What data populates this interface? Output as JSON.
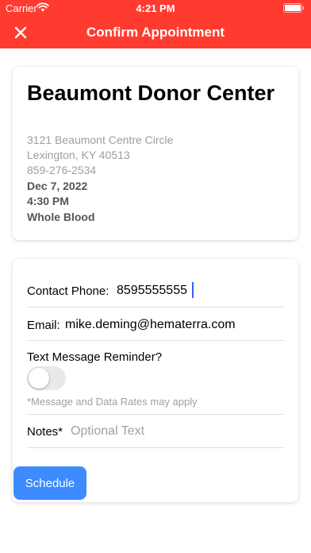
{
  "status_bar": {
    "carrier": "Carrier",
    "time": "4:21 PM"
  },
  "nav": {
    "title": "Confirm Appointment",
    "close_icon": "close-icon"
  },
  "center": {
    "name": "Beaumont Donor Center",
    "address_line1": "3121 Beaumont Centre Circle",
    "address_line2": "Lexington, KY 40513",
    "phone": "859-276-2534",
    "date": "Dec 7, 2022",
    "time": "4:30 PM",
    "donation_type": "Whole Blood"
  },
  "form": {
    "contact_phone_label": "Contact Phone:",
    "contact_phone_value": "8595555555",
    "email_label": "Email:",
    "email_value": "mike.deming@hematerra.com",
    "text_reminder_label": "Text Message Reminder?",
    "text_reminder_on": false,
    "disclaimer": "*Message and Data Rates may apply",
    "notes_label": "Notes*",
    "notes_placeholder": "Optional Text"
  },
  "actions": {
    "schedule_label": "Schedule"
  },
  "colors": {
    "header": "#ff3b30",
    "button": "#3d8bff",
    "cursor": "#3d5cff"
  }
}
